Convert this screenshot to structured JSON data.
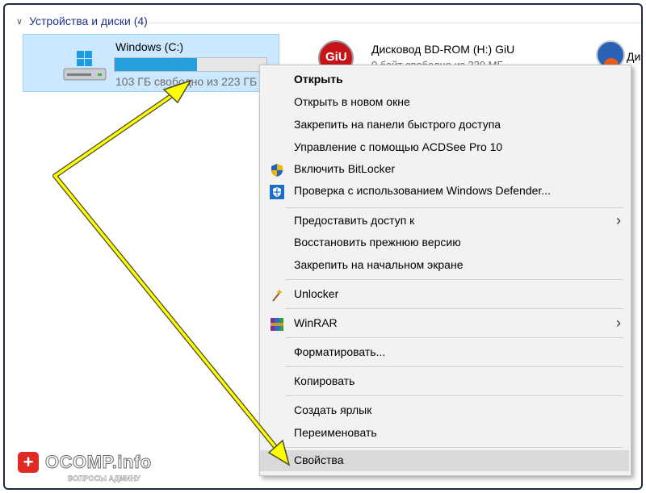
{
  "section": {
    "title": "Устройства и диски (4)"
  },
  "drives": {
    "c": {
      "title": "Windows (C:)",
      "free_text": "103 ГБ свободно из 223 ГБ",
      "used_fraction": 0.54
    },
    "bd": {
      "title": "Дисковод BD-ROM (H:) GiU",
      "free_text": "0 байт свободно из 330 МБ",
      "label": "GiU"
    },
    "third": {
      "title_partial": "Ди"
    }
  },
  "context_menu": {
    "items": [
      {
        "label": "Открыть",
        "bold": true
      },
      {
        "label": "Открыть в новом окне"
      },
      {
        "label": "Закрепить на панели быстрого доступа"
      },
      {
        "label": "Управление с помощью ACDSee Pro 10"
      },
      {
        "label": "Включить BitLocker",
        "icon": "bitlocker-shield-icon"
      },
      {
        "label": "Проверка с использованием Windows Defender...",
        "icon": "windows-defender-icon"
      },
      {
        "label": "Предоставить доступ к",
        "submenu": true
      },
      {
        "label": "Восстановить прежнюю версию"
      },
      {
        "label": "Закрепить на начальном экране"
      },
      {
        "label": "Unlocker",
        "icon": "unlocker-wand-icon"
      },
      {
        "label": "WinRAR",
        "icon": "winrar-icon",
        "submenu": true
      },
      {
        "label": "Форматировать..."
      },
      {
        "label": "Копировать"
      },
      {
        "label": "Создать ярлык"
      },
      {
        "label": "Переименовать"
      },
      {
        "label": "Свойства",
        "highlighted": true
      }
    ]
  },
  "watermark": {
    "symbol": "+",
    "brand": "OCOMP.info",
    "slogan": "ВОПРОСЫ АДМИНУ"
  },
  "colors": {
    "selection": "#cce8ff",
    "progress": "#26a0da",
    "arrow": "#ffff00",
    "header_text": "#1e3287"
  }
}
